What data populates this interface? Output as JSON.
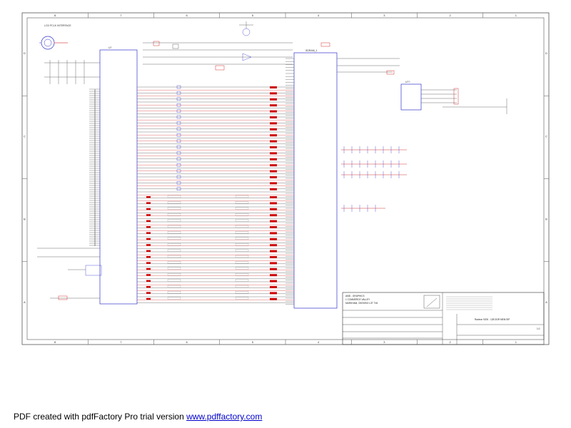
{
  "border": {
    "columns_top": [
      "8",
      "7",
      "6",
      "5",
      "4",
      "3",
      "2",
      "1"
    ],
    "columns_bottom": [
      "8",
      "7",
      "6",
      "5",
      "4",
      "3",
      "2",
      "1"
    ],
    "rows_left": [
      "D",
      "C",
      "B",
      "A"
    ],
    "rows_right": [
      "D",
      "C",
      "B",
      "A"
    ]
  },
  "schematic": {
    "interface_label": "LCD PCLK INTERFACE",
    "u1_label": "U?",
    "u2_label": "SDRAM_1",
    "u3_label": "U??",
    "net_color": "#cc0000",
    "wire_color": "#222222",
    "accent_color": "#3333cc"
  },
  "title_block": {
    "company_lines": [
      "AMD - GRAPHICS",
      "1 COMMERCE VALLEY",
      "MARKHAM, ONTARIO L3T 7X6"
    ],
    "title_label": "Radeon 9200 - 128 DDR MEM SIP",
    "revision": "1.0"
  },
  "footer": {
    "prefix": "PDF created with pdfFactory Pro trial version ",
    "link_text": "www.pdffactory.com"
  }
}
